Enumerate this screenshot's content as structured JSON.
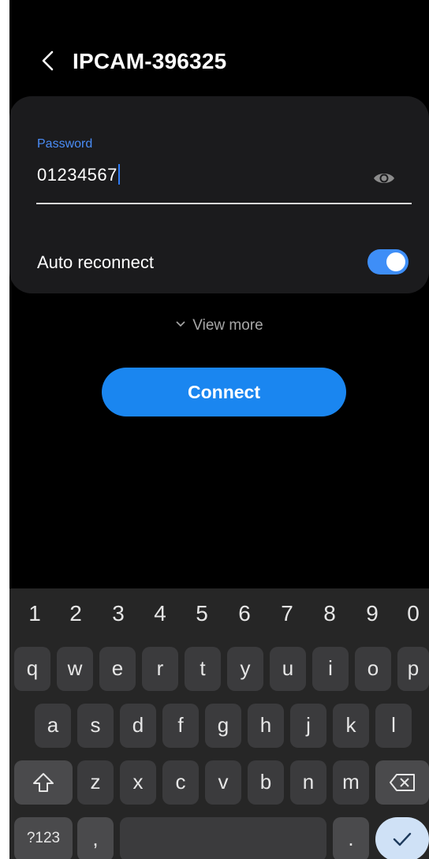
{
  "header": {
    "title": "IPCAM-396325"
  },
  "password": {
    "label": "Password",
    "value": "01234567"
  },
  "auto_reconnect": {
    "label": "Auto reconnect",
    "enabled": true
  },
  "view_more": {
    "label": "View more"
  },
  "connect_button": {
    "label": "Connect"
  },
  "keyboard": {
    "numbers": [
      "1",
      "2",
      "3",
      "4",
      "5",
      "6",
      "7",
      "8",
      "9",
      "0"
    ],
    "row1": [
      "q",
      "w",
      "e",
      "r",
      "t",
      "y",
      "u",
      "i",
      "o",
      "p"
    ],
    "row2": [
      "a",
      "s",
      "d",
      "f",
      "g",
      "h",
      "j",
      "k",
      "l"
    ],
    "row3": [
      "z",
      "x",
      "c",
      "v",
      "b",
      "n",
      "m"
    ],
    "symbols_label": "?123",
    "comma_label": ",",
    "period_label": "."
  },
  "colors": {
    "accent": "#1a86f0",
    "toggle": "#3e8ef7",
    "label_blue": "#4a8df8",
    "background": "#000000",
    "card": "#1b1b1d"
  }
}
